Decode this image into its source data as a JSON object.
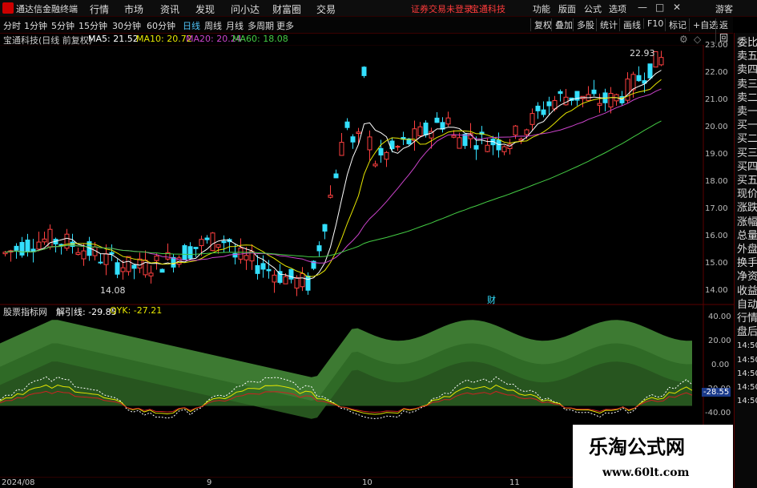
{
  "app": {
    "title": "通达信金融终端",
    "menu": [
      "行情",
      "市场",
      "资讯",
      "发现",
      "问小达",
      "财富圈",
      "交易"
    ],
    "login_notice": "证券交易未登录",
    "stock_name_top": "宝通科技",
    "right_menu": [
      "功能",
      "版面",
      "公式",
      "选项",
      "游客"
    ],
    "window_buttons": [
      "—",
      "□",
      "✕"
    ]
  },
  "toolbar": {
    "periods": [
      "分时",
      "1分钟",
      "5分钟",
      "15分钟",
      "30分钟",
      "60分钟",
      "日线",
      "周线",
      "月线",
      "多周期",
      "更多"
    ],
    "active_period": "日线",
    "right_buttons": [
      "复权",
      "叠加",
      "多股",
      "统计",
      "画线",
      "F10",
      "标记",
      "+自选",
      "返回"
    ]
  },
  "price_panel": {
    "header": "宝通科技(日线 前复权)",
    "ma5": "MA5: 21.52",
    "ma10": "MA10: 20.72",
    "ma20": "MA20: 20.24",
    "ma60": "MA60: 18.08",
    "high_label": "22.93",
    "low_label": "14.08",
    "marker": "财",
    "axis_ticks": [
      "23.00",
      "22.00",
      "21.00",
      "20.00",
      "19.00",
      "18.00",
      "17.00",
      "16.00",
      "15.00",
      "14.00"
    ],
    "colors": {
      "ma5": "#ffffff",
      "ma10": "#e6e600",
      "ma20": "#cc44cc",
      "ma60": "#44cc44",
      "up": "#ff4040",
      "down": "#33e0ff"
    }
  },
  "indicator_panel": {
    "name": "股票指标网",
    "line1": "解引线: -29.85",
    "line2": "QYK: -27.21",
    "axis_ticks": [
      "40.00",
      "20.00",
      "0.00",
      "-20.00",
      "-40.00"
    ],
    "current_value": "-28.55"
  },
  "date_axis": [
    "2024/08",
    "9",
    "10",
    "11"
  ],
  "right_panel": {
    "items": [
      "委比",
      "卖五",
      "卖四",
      "卖三",
      "卖二",
      "卖一",
      "买一",
      "买二",
      "买三",
      "买四",
      "买五",
      "现价",
      "涨跌",
      "涨幅",
      "总量",
      "外盘",
      "换手",
      "净资",
      "收益",
      "自动",
      "行情",
      "盘后",
      "14:50",
      "14:50",
      "14:50",
      "14:50",
      "14:50"
    ]
  },
  "watermark": {
    "title": "乐淘公式网",
    "url": "www.60lt.com"
  }
}
